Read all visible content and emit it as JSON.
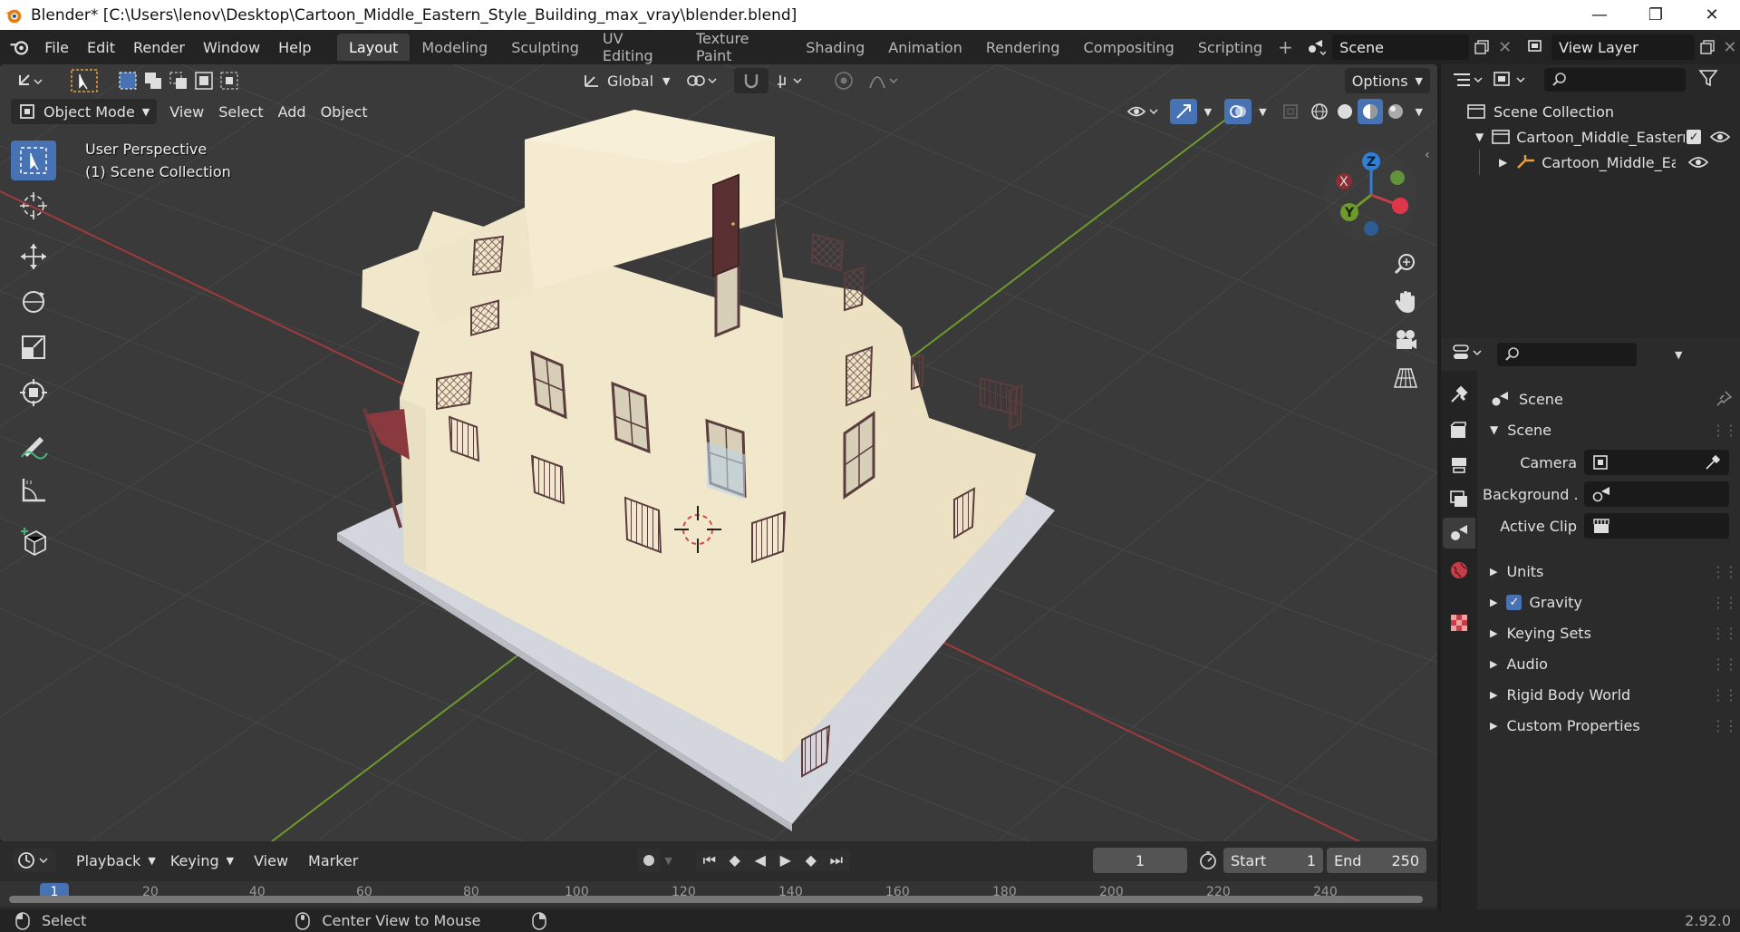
{
  "window": {
    "title": "Blender* [C:\\Users\\lenov\\Desktop\\Cartoon_Middle_Eastern_Style_Building_max_vray\\blender.blend]",
    "minimize": "—",
    "maximize": "❐",
    "close": "✕"
  },
  "menu": [
    "File",
    "Edit",
    "Render",
    "Window",
    "Help"
  ],
  "workspaces": [
    "Layout",
    "Modeling",
    "Sculpting",
    "UV Editing",
    "Texture Paint",
    "Shading",
    "Animation",
    "Rendering",
    "Compositing",
    "Scripting"
  ],
  "active_workspace": "Layout",
  "scene_field": "Scene",
  "view_layer_field": "View Layer",
  "viewport": {
    "transform_orientation": "Global",
    "options": "Options",
    "mode": "Object Mode",
    "menus": [
      "View",
      "Select",
      "Add",
      "Object"
    ],
    "overlay_line1": "User Perspective",
    "overlay_line2": "(1) Scene Collection",
    "gizmo": {
      "x": "X",
      "y": "Y",
      "z": "Z"
    }
  },
  "outliner": {
    "rows": [
      "Scene Collection",
      "Cartoon_Middle_Eastern_",
      "Cartoon_Middle_East"
    ]
  },
  "properties": {
    "header": "Scene",
    "panel": "Scene",
    "camera_label": "Camera",
    "background_label": "Background ...",
    "active_clip_label": "Active Clip",
    "sections": [
      "Units",
      "Gravity",
      "Keying Sets",
      "Audio",
      "Rigid Body World",
      "Custom Properties"
    ],
    "gravity_checked": true
  },
  "timeline": {
    "menus": [
      "Playback",
      "Keying",
      "View",
      "Marker"
    ],
    "current_frame": "1",
    "start_label": "Start",
    "start_value": "1",
    "end_label": "End",
    "end_value": "250",
    "ruler": [
      "1",
      "20",
      "40",
      "60",
      "80",
      "100",
      "120",
      "140",
      "160",
      "180",
      "200",
      "220",
      "240"
    ]
  },
  "status": {
    "left": "Select",
    "middle": "Center View to Mouse",
    "version": "2.92.0"
  },
  "colors": {
    "accent": "#4772b3",
    "wall": "#f1e8cc",
    "base": "#d3d6dc",
    "x_axis": "#a03a3a",
    "y_axis": "#6e9a2c"
  }
}
